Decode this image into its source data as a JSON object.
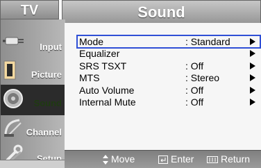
{
  "header": {
    "left_title": "TV",
    "title": "Sound"
  },
  "sidebar": {
    "items": [
      {
        "label": "Input",
        "icon": "input-plug-icon"
      },
      {
        "label": "Picture",
        "icon": "picture-icon"
      },
      {
        "label": "Sound",
        "icon": "speaker-icon",
        "active": true
      },
      {
        "label": "Channel",
        "icon": "satellite-dish-icon"
      },
      {
        "label": "Setup",
        "icon": "setup-wrench-icon"
      }
    ]
  },
  "menu": {
    "items": [
      {
        "label": "Mode",
        "value": ": Standard",
        "selected": true
      },
      {
        "label": "Equalizer",
        "value": ""
      },
      {
        "label": "SRS TSXT",
        "value": ": Off"
      },
      {
        "label": "MTS",
        "value": ": Stereo"
      },
      {
        "label": "Auto Volume",
        "value": ": Off"
      },
      {
        "label": "Internal Mute",
        "value": ": Off"
      }
    ]
  },
  "footer": {
    "move": "Move",
    "enter": "Enter",
    "return": "Return"
  },
  "colors": {
    "selection_outline": "#2f4fd6",
    "active_sidebar": "#2b2b2b"
  }
}
